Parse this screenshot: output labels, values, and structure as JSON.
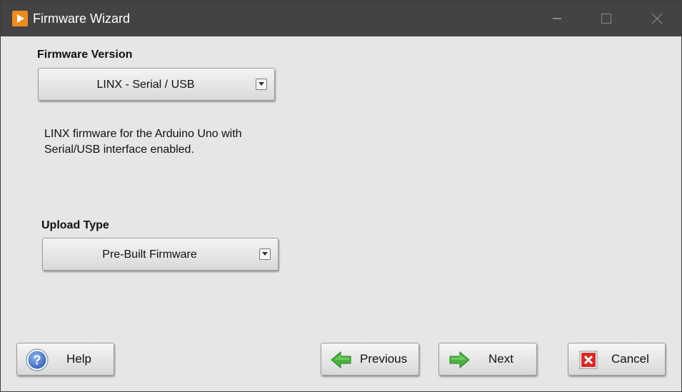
{
  "window": {
    "title": "Firmware Wizard",
    "app_icon": "play-triangle-icon",
    "controls": [
      "minimize-icon",
      "maximize-icon",
      "close-icon"
    ]
  },
  "firmware_version": {
    "label": "Firmware Version",
    "selected": "LINX - Serial / USB",
    "description_line1": "LINX firmware for the Arduino Uno with",
    "description_line2": "Serial/USB interface enabled."
  },
  "upload_type": {
    "label": "Upload Type",
    "selected": "Pre-Built Firmware"
  },
  "buttons": {
    "help": "Help",
    "previous": "Previous",
    "next": "Next",
    "cancel": "Cancel"
  },
  "colors": {
    "titlebar": "#434343",
    "window_bg": "#e6e6e6",
    "accent_orange": "#f08a1c",
    "arrow_green": "#49b33d",
    "cancel_red": "#d92a27",
    "help_blue": "#2f62b8"
  }
}
